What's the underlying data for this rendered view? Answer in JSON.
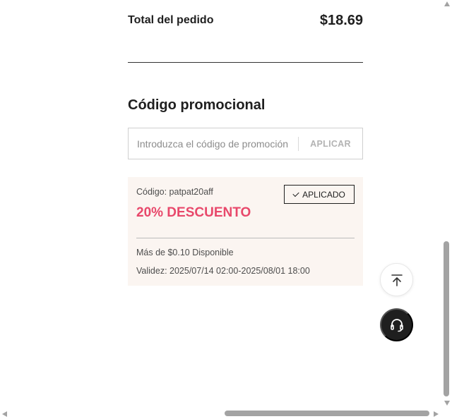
{
  "order_summary": {
    "total_label": "Total del pedido",
    "total_value": "$18.69"
  },
  "promo": {
    "title": "Código promocional",
    "input_placeholder": "Introduzca el código de promoción",
    "input_value": "",
    "apply_label": "APLICAR"
  },
  "coupon": {
    "code_text": "Código: patpat20aff",
    "applied_label": "APLICADO",
    "discount_text": "20% DESCUENTO",
    "minimum_text": "Más de $0.10 Disponible",
    "validity_text": "Validez: 2025/07/14 02:00-2025/08/01 18:00"
  },
  "icons": {
    "applied": "check-icon",
    "back_to_top": "arrow-to-top-icon",
    "support": "headset-icon"
  },
  "colors": {
    "discount": "#e8486b",
    "coupon_bg": "#fbf5f1",
    "support_button_bg": "#1f1f1f",
    "apply_text": "#b3b3b3"
  },
  "scroll": {
    "vertical_position": 0.74,
    "horizontal_position": 0.55
  }
}
